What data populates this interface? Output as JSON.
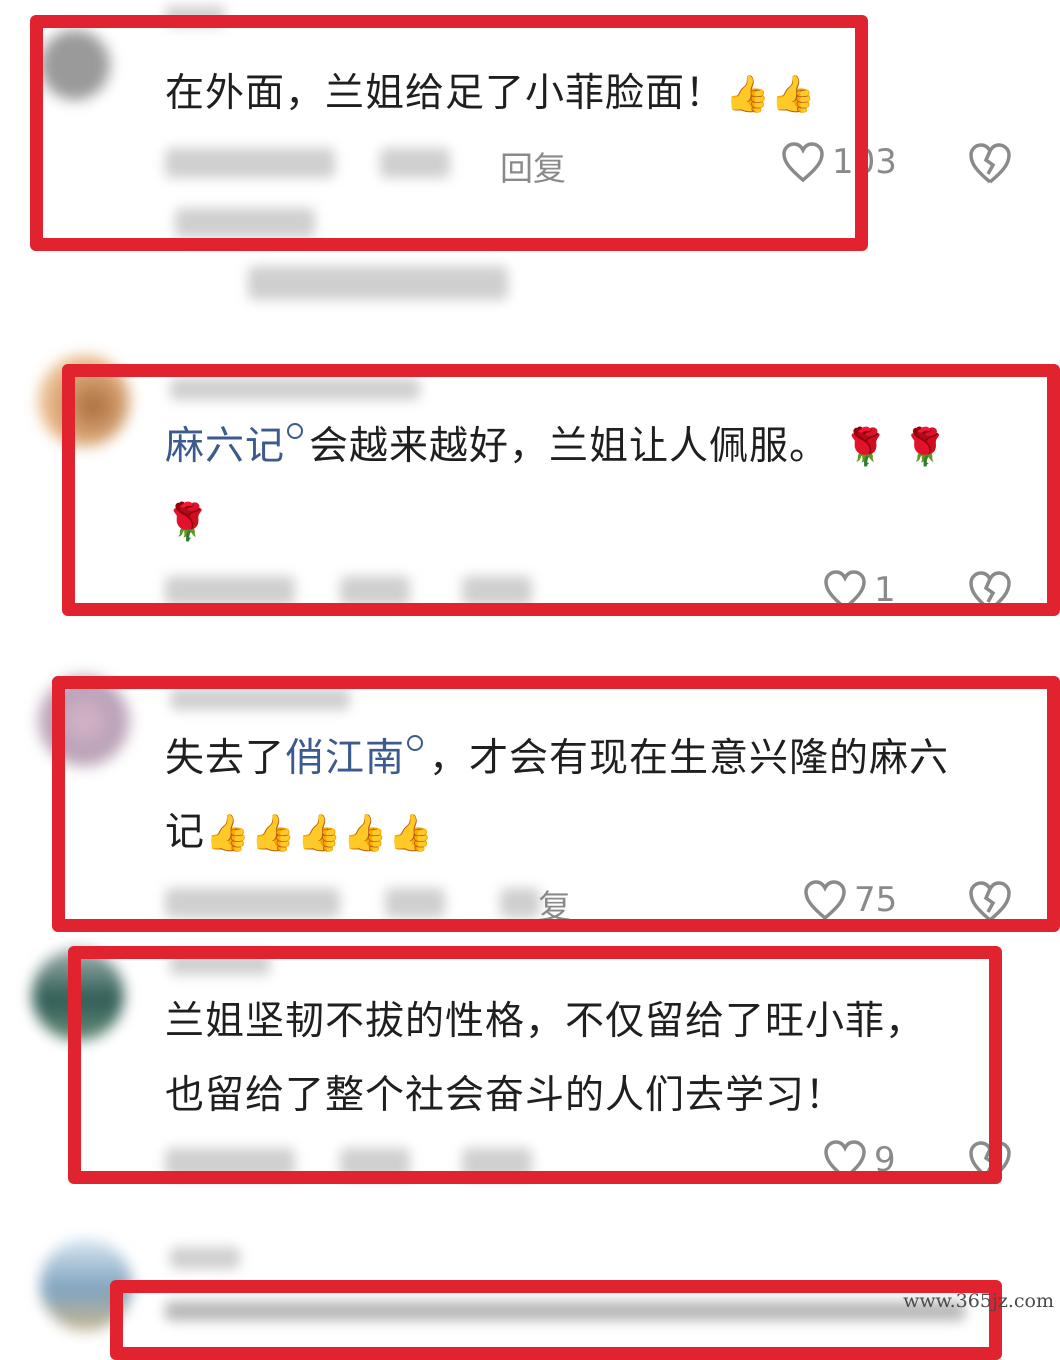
{
  "comments": [
    {
      "text": "在外面，兰姐给足了小菲脸面！",
      "emojis": [
        "👍",
        "👍"
      ],
      "reply_label": "回复",
      "likes": "103"
    },
    {
      "mention": "麻六记",
      "text": "会越来越好，兰姐让人佩服。",
      "emojis_line1": [
        "🌹",
        "🌹"
      ],
      "emojis_line2": [
        "🌹"
      ],
      "likes": "1"
    },
    {
      "text_before": "失去了",
      "mention": "俏江南",
      "text_after": "，才会有现在生意兴隆的麻六",
      "text_line2": "记",
      "emojis": [
        "👍",
        "👍",
        "👍",
        "👍",
        "👍"
      ],
      "reply_label": "复",
      "likes": "75"
    },
    {
      "line1": "兰姐坚韧不拔的性格，不仅留给了旺小菲，",
      "line2": "也留给了整个社会奋斗的人们去学习！",
      "likes": "9"
    }
  ],
  "watermark": "www.365jz.com",
  "colors": {
    "highlight_box": "#e1232f",
    "mention": "#3d5a8c",
    "meta_gray": "#8a8a8a"
  },
  "icons": [
    "heart-outline-icon",
    "broken-heart-icon",
    "search-icon"
  ]
}
